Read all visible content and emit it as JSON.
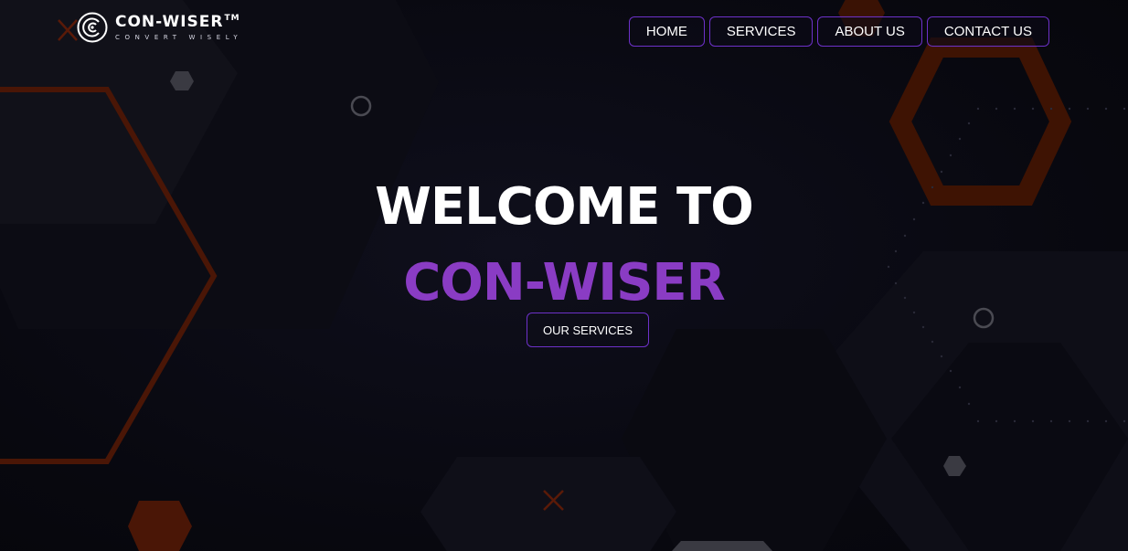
{
  "brand": {
    "name": "CON-WISER",
    "trademark": "TM",
    "tagline": "CONVERT WISELY",
    "logo_icon": "concentric-c-logo-icon"
  },
  "nav": {
    "items": [
      {
        "label": "HOME"
      },
      {
        "label": "SERVICES"
      },
      {
        "label": "ABOUT US"
      },
      {
        "label": "CONTACT US"
      }
    ]
  },
  "hero": {
    "line1": "WELCOME TO",
    "line2": "CON-WISER",
    "cta_label": "OUR SERVICES"
  },
  "colors": {
    "background": "#0b0b14",
    "accent_purple": "#8a3cc4",
    "button_border": "#6d31c9",
    "hex_orange": "#5a1a05"
  }
}
